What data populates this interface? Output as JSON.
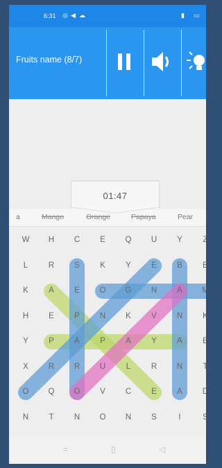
{
  "status": {
    "time": "6:31"
  },
  "header": {
    "title": "Fruits name (8/7)"
  },
  "timer": "01:47",
  "words": [
    {
      "text": "a",
      "found": false
    },
    {
      "text": "Mango",
      "found": true
    },
    {
      "text": "Orange",
      "found": true
    },
    {
      "text": "Papaya",
      "found": true
    },
    {
      "text": "Pear",
      "found": false
    }
  ],
  "grid": [
    [
      "W",
      "H",
      "C",
      "E",
      "Q",
      "U",
      "Y",
      "Z"
    ],
    [
      "L",
      "R",
      "S",
      "K",
      "Y",
      "E",
      "B",
      "E"
    ],
    [
      "K",
      "A",
      "E",
      "O",
      "G",
      "N",
      "A",
      "M"
    ],
    [
      "H",
      "E",
      "P",
      "N",
      "K",
      "V",
      "N",
      "K"
    ],
    [
      "Y",
      "P",
      "A",
      "P",
      "A",
      "Y",
      "A",
      "E"
    ],
    [
      "X",
      "R",
      "R",
      "U",
      "L",
      "R",
      "N",
      "T"
    ],
    [
      "O",
      "Q",
      "O",
      "V",
      "C",
      "E",
      "A",
      "D"
    ],
    [
      "N",
      "T",
      "N",
      "O",
      "N",
      "S",
      "I",
      "S"
    ]
  ],
  "highlights": [
    {
      "from": [
        2,
        1
      ],
      "to": [
        6,
        5
      ],
      "color": "#bcd86a"
    },
    {
      "from": [
        4,
        1
      ],
      "to": [
        4,
        6
      ],
      "color": "#bcd86a"
    },
    {
      "from": [
        1,
        2
      ],
      "to": [
        6,
        2
      ],
      "color": "#5b9bd5"
    },
    {
      "from": [
        2,
        3
      ],
      "to": [
        2,
        7
      ],
      "color": "#5b9bd5"
    },
    {
      "from": [
        1,
        6
      ],
      "to": [
        6,
        6
      ],
      "color": "#5b9bd5"
    },
    {
      "from": [
        1,
        5
      ],
      "to": [
        6,
        0
      ],
      "color": "#5b9bd5"
    },
    {
      "from": [
        2,
        6
      ],
      "to": [
        6,
        2
      ],
      "color": "#e26fc1"
    }
  ],
  "nav": {
    "home": "=",
    "recents": "▯",
    "back": "◁"
  },
  "colors": {
    "status_bar": "#1d86e6",
    "header": "#2a96f0",
    "background": "#eeeeee"
  }
}
